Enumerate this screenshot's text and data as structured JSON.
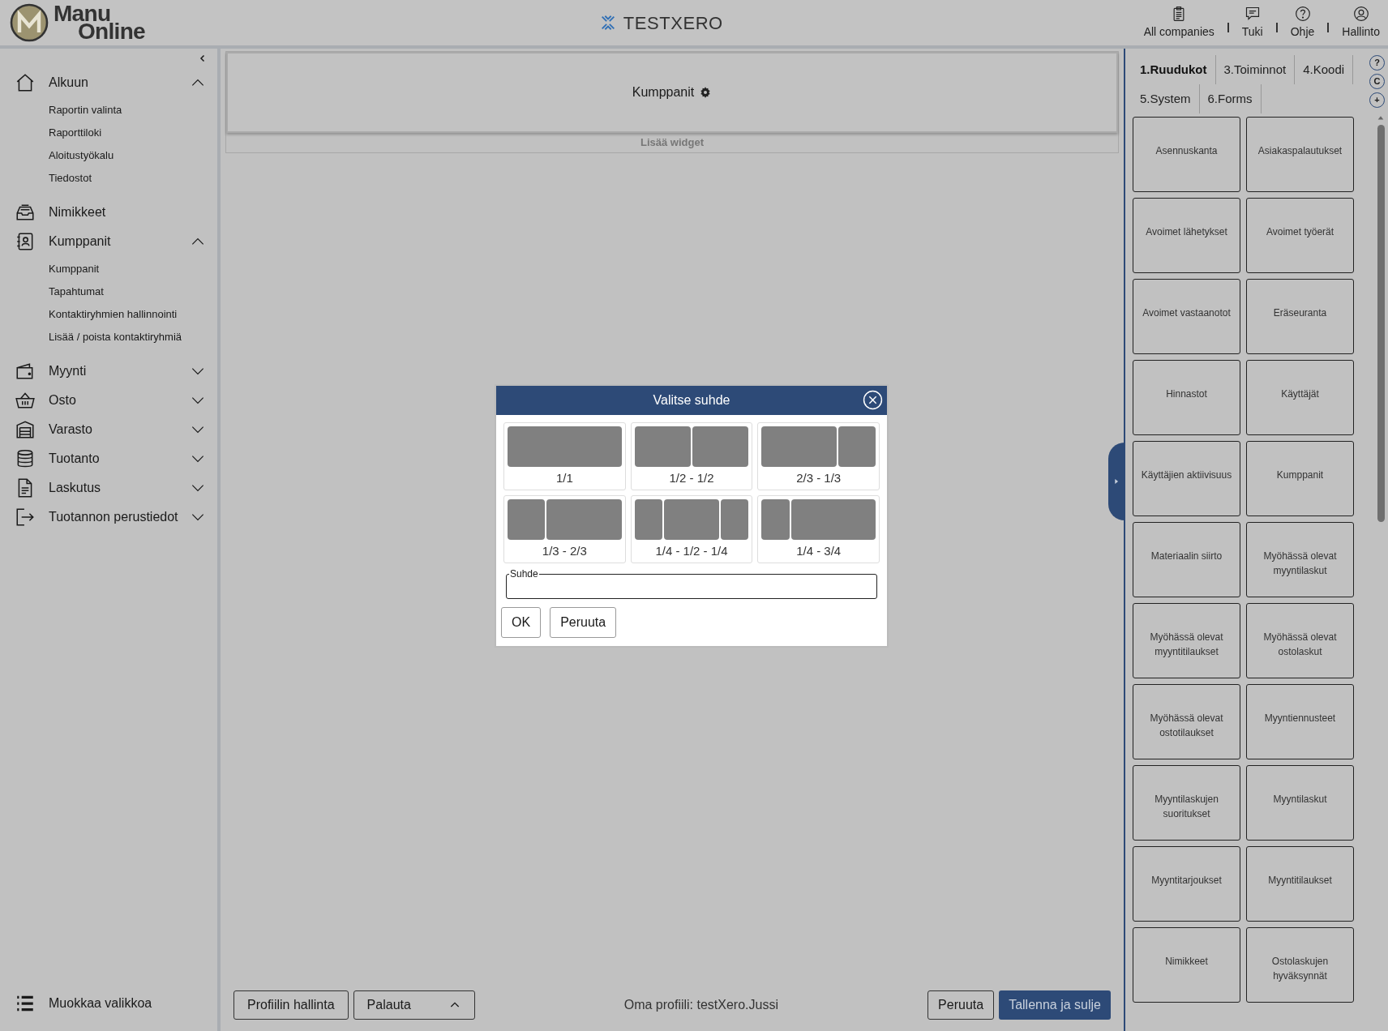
{
  "header": {
    "logo_line1": "Manu",
    "logo_line2": "Online",
    "company": "TESTXERO",
    "links": [
      {
        "label": "All companies",
        "kind": "clipboard"
      },
      {
        "label": "Tuki",
        "kind": "chat"
      },
      {
        "label": "Ohje",
        "kind": "help"
      },
      {
        "label": "Hallinto",
        "kind": "user"
      }
    ]
  },
  "sidebar": {
    "items": [
      {
        "label": "Alkuun",
        "kind": "home",
        "expanded": true,
        "children": [
          {
            "label": "Raportin valinta"
          },
          {
            "label": "Raporttiloki"
          },
          {
            "label": "Aloitustyökalu"
          },
          {
            "label": "Tiedostot"
          }
        ]
      },
      {
        "label": "Nimikkeet",
        "kind": "tray"
      },
      {
        "label": "Kumppanit",
        "kind": "contacts",
        "expanded": true,
        "children": [
          {
            "label": "Kumppanit"
          },
          {
            "label": "Tapahtumat"
          },
          {
            "label": "Kontaktiryhmien hallinnointi"
          },
          {
            "label": "Lisää / poista kontaktiryhmiä"
          }
        ]
      },
      {
        "label": "Myynti",
        "kind": "wallet",
        "expanded": false
      },
      {
        "label": "Osto",
        "kind": "basket",
        "expanded": false
      },
      {
        "label": "Varasto",
        "kind": "warehouse",
        "expanded": false
      },
      {
        "label": "Tuotanto",
        "kind": "database",
        "expanded": false
      },
      {
        "label": "Laskutus",
        "kind": "document",
        "expanded": false
      },
      {
        "label": "Tuotannon perustiedot",
        "kind": "exit",
        "expanded": false
      }
    ],
    "footer": "Muokkaa valikkoa"
  },
  "widget": {
    "title": "Kumppanit",
    "add_label": "Lisää widget"
  },
  "bottom_bar": {
    "profile_button": "Profiilin hallinta",
    "restore": "Palauta",
    "profile_text": "Oma profiili: testXero.Jussi",
    "cancel": "Peruuta",
    "save": "Tallenna ja sulje"
  },
  "dialog": {
    "title": "Valitse suhde",
    "options": [
      {
        "label": "1/1",
        "kind": "full"
      },
      {
        "label": "1/2 - 1/2",
        "kind": "halves"
      },
      {
        "label": "2/3 - 1/3",
        "kind": "two-one"
      },
      {
        "label": "1/3 - 2/3",
        "kind": "one-two"
      },
      {
        "label": "1/4 - 1/2 - 1/4",
        "kind": "quarter-half-quarter"
      },
      {
        "label": "1/4 - 3/4",
        "kind": "quarter-three"
      }
    ],
    "field_label": "Suhde",
    "ok": "OK",
    "cancel": "Peruuta"
  },
  "right_panel": {
    "tabs": [
      {
        "label": "1.Ruudukot",
        "selected": true
      },
      {
        "label": "3.Toiminnot",
        "selected": false
      },
      {
        "label": "4.Koodi",
        "selected": false
      },
      {
        "label": "5.System",
        "selected": false
      },
      {
        "label": "6.Forms",
        "selected": false
      }
    ],
    "side_buttons": [
      "?",
      "C",
      "+"
    ],
    "tiles": [
      "Asennuskanta",
      "Asiakaspalautukset",
      "Avoimet lähetykset",
      "Avoimet työerät",
      "Avoimet vastaanotot",
      "Eräseuranta",
      "Hinnastot",
      "Käyttäjät",
      "Käyttäjien aktiivisuus",
      "Kumppanit",
      "Materiaalin siirto",
      "Myöhässä olevat myyntilaskut",
      "Myöhässä olevat myyntitilaukset",
      "Myöhässä olevat ostolaskut",
      "Myöhässä olevat ostotilaukset",
      "Myyntiennusteet",
      "Myyntilaskujen suoritukset",
      "Myyntilaskut",
      "Myyntitarjoukset",
      "Myyntitilaukset",
      "Nimikkeet",
      "Ostolaskujen hyväksynnät"
    ]
  }
}
